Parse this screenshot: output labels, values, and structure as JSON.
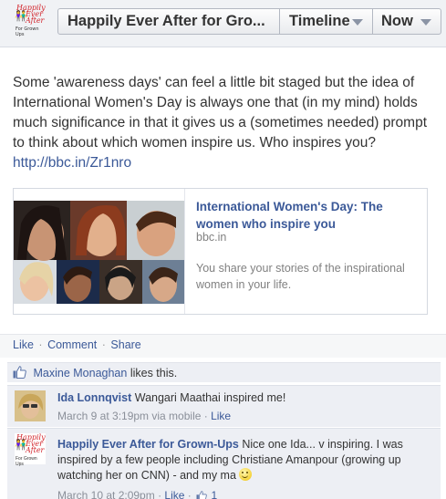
{
  "header": {
    "logo_lines": [
      "Happily",
      "Ever",
      "After",
      "For Grown",
      "Ups"
    ],
    "page_name": "Happily Ever After for Gro...",
    "timeline_label": "Timeline",
    "now_label": "Now"
  },
  "post": {
    "text": "Some 'awareness days' can feel a little bit staged but the idea of International Women's Day is always one that (in my mind) holds much significance in that it gives us a (sometimes needed) prompt to think about which women inspire us. Who inspires you?",
    "link": "http://bbc.in/Zr1nro"
  },
  "card": {
    "title": "International Women's Day: The women who inspire you",
    "domain": "bbc.in",
    "description": "You share your stories of the inspirational women in your life."
  },
  "actions": {
    "like": "Like",
    "comment": "Comment",
    "share": "Share",
    "separator": "·"
  },
  "likes": {
    "name": "Maxine Monaghan",
    "suffix": "likes this."
  },
  "comments": [
    {
      "author": "Ida Lonnqvist",
      "text": "Wangari Maathai inspired me!",
      "meta": "March 9 at 3:19pm via mobile",
      "like": "Like"
    },
    {
      "author": "Happily Ever After for Grown-Ups",
      "text": "Nice one Ida... v inspiring. I was inspired by a few people including Christiane Amanpour (growing up watching her on CNN) - and my ma",
      "meta": "March 10 at 2:09pm",
      "like": "Like",
      "like_count": "1"
    }
  ],
  "colors": {
    "link_blue": "#3b5998",
    "logo_red": "#d2232a",
    "panel_bg": "#edeff4"
  }
}
